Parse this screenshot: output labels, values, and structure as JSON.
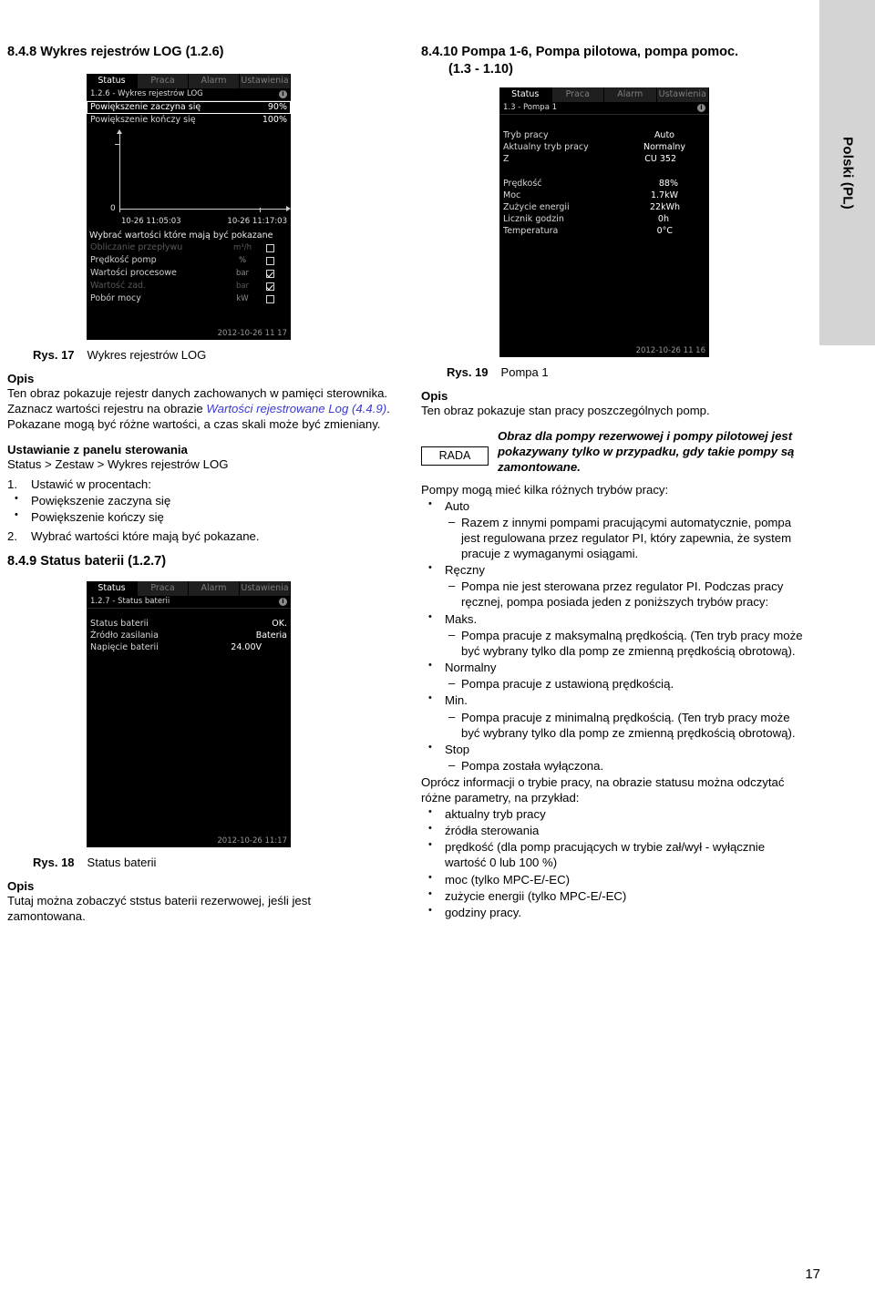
{
  "page": {
    "number": "17",
    "language_tab": "Polski (PL)"
  },
  "left_column": {
    "section_heading": "8.4.8 Wykres rejestrów LOG (1.2.6)",
    "screen1": {
      "tabs": [
        "Status",
        "Praca",
        "Alarm",
        "Ustawienia"
      ],
      "active_tab": "Status",
      "title": "1.2.6 - Wykres rejestrów LOG",
      "rows": [
        {
          "label": "Powiększenie zaczyna się",
          "value": "90%",
          "selected": true
        },
        {
          "label": "Powiększenie kończy się",
          "value": "100%",
          "selected": false
        }
      ],
      "chart": {
        "y_zero_label": "0",
        "x_label_left": "10-26 11:05:03",
        "x_label_right": "10-26 11:17:03"
      },
      "subheading": "Wybrać wartości które mają być pokazane",
      "checkbox_rows": [
        {
          "name": "Obliczanie przepływu",
          "unit": "m³/h",
          "checked": false,
          "dim": true
        },
        {
          "name": "Prędkość pomp",
          "unit": "%",
          "checked": false,
          "dim": false
        },
        {
          "name": "Wartości procesowe",
          "unit": "bar",
          "checked": true,
          "dim": false
        },
        {
          "name": "Wartość zad.",
          "unit": "bar",
          "checked": true,
          "dim": true
        },
        {
          "name": "Pobór mocy",
          "unit": "kW",
          "checked": false,
          "dim": false
        }
      ],
      "footer": "2012-10-26  11 17"
    },
    "fig17": {
      "num": "Rys. 17",
      "text": "Wykres rejestrów LOG"
    },
    "opis_heading": "Opis",
    "opis_part1": "Ten obraz pokazuje rejestr danych zachowanych w pamięci sterownika. Zaznacz wartości rejestru na obrazie ",
    "opis_link": "Wartości rejestrowane Log (4.4.9)",
    "opis_part2": ". Pokazane mogą być różne wartości, a czas skali może być zmieniany.",
    "settings_heading": "Ustawianie z panelu sterowania",
    "settings_path": "Status > Zestaw > Wykres rejestrów LOG",
    "steps": [
      {
        "idx": "1.",
        "text": "Ustawić w procentach:"
      },
      {
        "idx": "2.",
        "text": "Wybrać wartości które mają być pokazane."
      }
    ],
    "step1_bullets": [
      "Powiększenie zaczyna się",
      "Powiększenie kończy się"
    ],
    "section_heading_2": "8.4.9 Status baterii (1.2.7)",
    "screen2": {
      "tabs": [
        "Status",
        "Praca",
        "Alarm",
        "Ustawienia"
      ],
      "active_tab": "Status",
      "title": "1.2.7 - Status baterii",
      "rows": [
        {
          "label": "Status baterii",
          "value": "OK."
        },
        {
          "label": "Źródło zasilania",
          "value": "Bateria"
        },
        {
          "label": "Napięcie baterii",
          "value": "24.00V"
        }
      ],
      "footer": "2012-10-26  11:17"
    },
    "fig18": {
      "num": "Rys. 18",
      "text": "Status baterii"
    },
    "opis_heading_2": "Opis",
    "opis_text_2": "Tutaj można zobaczyć ststus baterii rezerwowej, jeśli jest zamontowana."
  },
  "right_column": {
    "section_heading_line1": "8.4.10 Pompa 1-6, Pompa pilotowa, pompa pomoc.",
    "section_heading_line2": "(1.3 - 1.10)",
    "screen3": {
      "tabs": [
        "Status",
        "Praca",
        "Alarm",
        "Ustawienia"
      ],
      "active_tab": "Status",
      "title": "1.3 - Pompa 1",
      "group1": [
        {
          "label": "Tryb pracy",
          "value": "Auto"
        },
        {
          "label": "Aktualny tryb pracy",
          "value": "Normalny"
        },
        {
          "label": "Z",
          "value": "CU 352"
        }
      ],
      "group2": [
        {
          "label": "Prędkość",
          "value": "88%"
        },
        {
          "label": "Moc",
          "value": "1.7kW"
        },
        {
          "label": "Zużycie energii",
          "value": "22kWh"
        },
        {
          "label": "Licznik godzin",
          "value": "0h"
        },
        {
          "label": "Temperatura",
          "value": "0°C"
        }
      ],
      "footer": "2012-10-26  11 16"
    },
    "fig19": {
      "num": "Rys. 19",
      "text": "Pompa 1"
    },
    "opis_heading": "Opis",
    "opis_text": "Ten obraz pokazuje stan pracy poszczególnych pomp.",
    "note": {
      "badge": "RADA",
      "text": "Obraz dla pompy rezerwowej i pompy pilotowej jest pokazywany tylko w przypadku, gdy takie pompy są zamontowane."
    },
    "modes_intro": "Pompy mogą mieć kilka różnych trybów pracy:",
    "modes": [
      {
        "name": "Auto",
        "desc": "Razem z innymi pompami pracującymi automatycznie, pompa jest regulowana przez regulator PI, który zapewnia, że system pracuje z wymaganymi osiągami."
      },
      {
        "name": "Ręczny",
        "desc": "Pompa nie jest sterowana przez regulator PI. Podczas pracy ręcznej, pompa posiada jeden z poniższych trybów pracy:"
      },
      {
        "name": "Maks.",
        "desc": "Pompa pracuje z maksymalną prędkością. (Ten tryb pracy może być wybrany tylko dla pomp ze zmienną prędkością obrotową)."
      },
      {
        "name": "Normalny",
        "desc": "Pompa pracuje z ustawioną prędkością."
      },
      {
        "name": "Min.",
        "desc": "Pompa pracuje z minimalną prędkością. (Ten tryb pracy może być wybrany tylko dla pomp ze zmienną prędkością obrotową)."
      },
      {
        "name": "Stop",
        "desc": "Pompa została wyłączona."
      }
    ],
    "params_intro": "Oprócz informacji o trybie pracy, na obrazie statusu można odczytać różne parametry, na przykład:",
    "params": [
      "aktualny tryb pracy",
      "źródła sterowania",
      "prędkość (dla pomp pracujących w trybie zał/wył - wyłącznie wartość 0 lub 100 %)",
      "moc (tylko MPC-E/-EC)",
      "zużycie energii (tylko MPC-E/-EC)",
      "godziny pracy."
    ]
  }
}
